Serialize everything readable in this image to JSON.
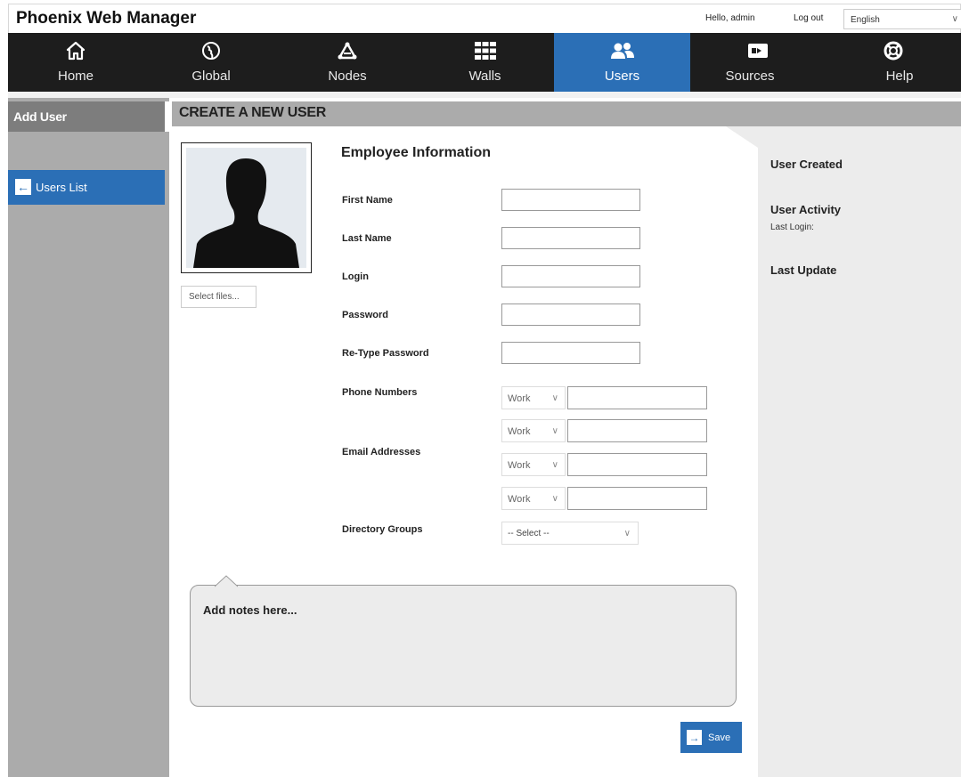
{
  "app": {
    "title": "Phoenix Web Manager"
  },
  "header": {
    "greeting": "Hello, admin",
    "logout": "Log out",
    "language": "English"
  },
  "nav": {
    "items": [
      {
        "label": "Home",
        "icon": "home-icon"
      },
      {
        "label": "Global",
        "icon": "globe-icon"
      },
      {
        "label": "Nodes",
        "icon": "nodes-icon"
      },
      {
        "label": "Walls",
        "icon": "walls-grid-icon"
      },
      {
        "label": "Users",
        "icon": "users-icon",
        "active": true
      },
      {
        "label": "Sources",
        "icon": "camera-icon"
      },
      {
        "label": "Help",
        "icon": "lifebuoy-icon"
      }
    ]
  },
  "sidebar": {
    "title": "Add User",
    "users_list": "Users List"
  },
  "main": {
    "title": "CREATE A NEW USER"
  },
  "avatar": {
    "select_files": "Select files..."
  },
  "form": {
    "section_title": "Employee Information",
    "first_name": "First Name",
    "last_name": "Last Name",
    "login": "Login",
    "password": "Password",
    "retype_password": "Re-Type Password",
    "phone_numbers": "Phone Numbers",
    "email_addresses": "Email Addresses",
    "directory_groups": "Directory Groups",
    "phone_type": "Work",
    "email_types": [
      "Work",
      "Work",
      "Work"
    ],
    "directory_select": "-- Select --"
  },
  "right_panel": {
    "user_created": "User Created",
    "user_activity": "User Activity",
    "last_login": "Last Login:",
    "last_update": "Last Update"
  },
  "notes": {
    "placeholder": "Add notes here..."
  },
  "actions": {
    "save": "Save"
  },
  "colors": {
    "accent": "#2b6fb6",
    "nav_bg": "#1d1d1d",
    "sidebar_bg": "#ababab",
    "panel_bg": "#ececec"
  }
}
